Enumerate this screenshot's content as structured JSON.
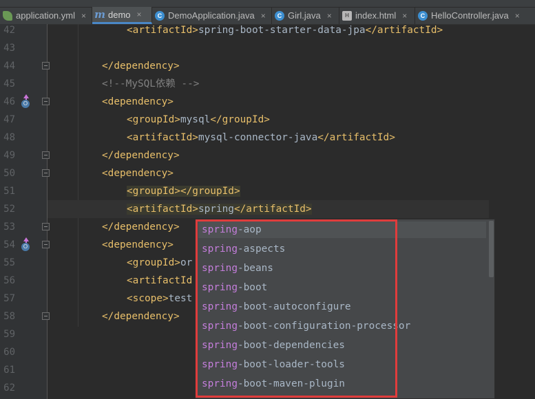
{
  "tabs": [
    {
      "label": "application.yml",
      "icon": "spring-leaf-icon",
      "active": false
    },
    {
      "label": "demo",
      "icon": "maven-m-icon",
      "active": true
    },
    {
      "label": "DemoApplication.java",
      "icon": "class-c-icon",
      "active": false
    },
    {
      "label": "Girl.java",
      "icon": "class-c-icon",
      "active": false
    },
    {
      "label": "index.html",
      "icon": "html-file-icon",
      "active": false
    },
    {
      "label": "HelloController.java",
      "icon": "class-c-icon",
      "active": false
    }
  ],
  "close_glyph": "×",
  "line_numbers": [
    "42",
    "43",
    "44",
    "45",
    "46",
    "47",
    "48",
    "49",
    "50",
    "51",
    "52",
    "53",
    "54",
    "55",
    "56",
    "57",
    "58",
    "59",
    "60",
    "61",
    "62"
  ],
  "code": {
    "l42": {
      "open": "<artifactId>",
      "text": "spring-boot-starter-data-jpa",
      "close": "</artifactId>"
    },
    "l44": {
      "close": "</dependency>"
    },
    "l45": {
      "comment": "<!--MySQL依赖 -->"
    },
    "l46": {
      "open": "<dependency>"
    },
    "l47": {
      "open": "<groupId>",
      "text": "mysql",
      "close": "</groupId>"
    },
    "l48": {
      "open": "<artifactId>",
      "text": "mysql-connector-java",
      "close": "</artifactId>"
    },
    "l49": {
      "close": "</dependency>"
    },
    "l50": {
      "open": "<dependency>"
    },
    "l51": {
      "open": "<groupId>",
      "close": "</groupId>"
    },
    "l52": {
      "open": "<artifactId>",
      "text": "spring",
      "close": "</artifactId>"
    },
    "l53": {
      "close": "</dependency>"
    },
    "l54": {
      "open": "<dependency>"
    },
    "l55": {
      "open": "<groupId>",
      "text": "or"
    },
    "l56": {
      "open": "<artifactId"
    },
    "l57": {
      "open": "<scope>",
      "text": "test"
    },
    "l58": {
      "close": "</dependency>"
    }
  },
  "completion": {
    "match_prefix": "spring",
    "items": [
      "-aop",
      "-aspects",
      "-beans",
      "-boot",
      "-boot-autoconfigure",
      "-boot-configuration-processor",
      "-boot-dependencies",
      "-boot-loader-tools",
      "-boot-maven-plugin"
    ],
    "selected_index": 0
  },
  "colors": {
    "tag": "#e8bf6a",
    "comment": "#808080",
    "match": "#c47edb",
    "highlight_box": "#e03c3c"
  }
}
